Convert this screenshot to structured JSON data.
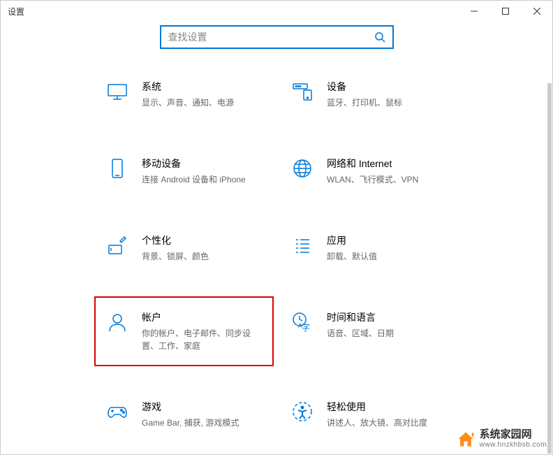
{
  "titlebar": {
    "title": "设置"
  },
  "search": {
    "placeholder": "查找设置"
  },
  "items": [
    {
      "id": "system",
      "title": "系统",
      "desc": "显示、声音、通知、电源"
    },
    {
      "id": "devices",
      "title": "设备",
      "desc": "蓝牙、打印机、鼠标"
    },
    {
      "id": "phone",
      "title": "移动设备",
      "desc": "连接 Android 设备和 iPhone"
    },
    {
      "id": "network",
      "title": "网络和 Internet",
      "desc": "WLAN、飞行模式、VPN"
    },
    {
      "id": "personalization",
      "title": "个性化",
      "desc": "背景、锁屏、颜色"
    },
    {
      "id": "apps",
      "title": "应用",
      "desc": "卸载、默认值"
    },
    {
      "id": "accounts",
      "title": "帐户",
      "desc": "你的帐户、电子邮件、同步设置、工作、家庭"
    },
    {
      "id": "time-language",
      "title": "时间和语言",
      "desc": "语音、区域、日期"
    },
    {
      "id": "gaming",
      "title": "游戏",
      "desc": "Game Bar, 捕获, 游戏模式"
    },
    {
      "id": "ease-of-access",
      "title": "轻松使用",
      "desc": "讲述人、放大镜、高对比度"
    }
  ],
  "highlighted_index": 6,
  "watermark": {
    "cn": "系统家园网",
    "url": "www.hnzkhbsb.com"
  }
}
